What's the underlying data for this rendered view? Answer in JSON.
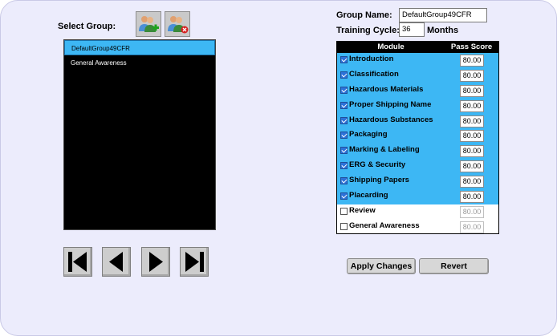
{
  "select_group_label": "Select Group:",
  "groups": [
    {
      "name": "DefaultGroup49CFR",
      "selected": true
    },
    {
      "name": "General Awareness",
      "selected": false
    }
  ],
  "add_group_icon": "add-group-icon",
  "remove_group_icon": "remove-group-icon",
  "nav": {
    "first": "first-icon",
    "prev": "previous-icon",
    "next": "next-icon",
    "last": "last-icon"
  },
  "group_name_label": "Group Name:",
  "group_name_value": "DefaultGroup49CFR",
  "training_cycle_label": "Training Cycle:",
  "training_cycle_value": "36",
  "months_label": "Months",
  "table": {
    "col_module": "Module",
    "col_pass_score": "Pass Score",
    "rows": [
      {
        "module": "Introduction",
        "checked": true,
        "score": "80.00"
      },
      {
        "module": "Classification",
        "checked": true,
        "score": "80.00"
      },
      {
        "module": "Hazardous Materials",
        "checked": true,
        "score": "80.00"
      },
      {
        "module": "Proper Shipping Name",
        "checked": true,
        "score": "80.00"
      },
      {
        "module": "Hazardous Substances",
        "checked": true,
        "score": "80.00"
      },
      {
        "module": "Packaging",
        "checked": true,
        "score": "80.00"
      },
      {
        "module": "Marking & Labeling",
        "checked": true,
        "score": "80.00"
      },
      {
        "module": "ERG & Security",
        "checked": true,
        "score": "80.00"
      },
      {
        "module": "Shipping Papers",
        "checked": true,
        "score": "80.00"
      },
      {
        "module": "Placarding",
        "checked": true,
        "score": "80.00"
      },
      {
        "module": "Review",
        "checked": false,
        "score": "80.00"
      },
      {
        "module": "General Awareness",
        "checked": false,
        "score": "80.00"
      }
    ]
  },
  "apply_label": "Apply Changes",
  "revert_label": "Revert",
  "colors": {
    "highlight": "#3db7f4",
    "list_bg": "#000000",
    "panel_bg": "#ececfc"
  }
}
